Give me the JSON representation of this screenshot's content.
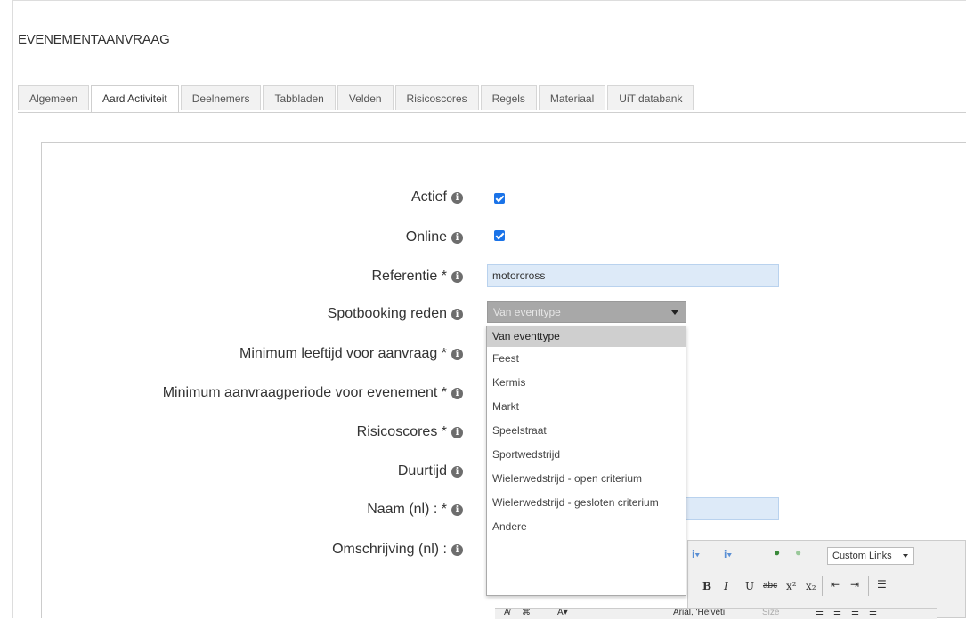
{
  "page": {
    "title": "EVENEMENTAANVRAAG"
  },
  "tabs": [
    {
      "label": "Algemeen",
      "active": false
    },
    {
      "label": "Aard Activiteit",
      "active": true
    },
    {
      "label": "Deelnemers",
      "active": false
    },
    {
      "label": "Tabbladen",
      "active": false
    },
    {
      "label": "Velden",
      "active": false
    },
    {
      "label": "Risicoscores",
      "active": false
    },
    {
      "label": "Regels",
      "active": false
    },
    {
      "label": "Materiaal",
      "active": false
    },
    {
      "label": "UiT databank",
      "active": false
    }
  ],
  "form": {
    "actief": {
      "label": "Actief",
      "checked": true
    },
    "online": {
      "label": "Online",
      "checked": true
    },
    "referentie": {
      "label": "Referentie *",
      "value": "motorcross"
    },
    "spotbooking": {
      "label": "Spotbooking reden",
      "selected": "Van eventtype",
      "options": [
        "Van eventtype",
        "Feest",
        "Kermis",
        "Markt",
        "Speelstraat",
        "Sportwedstrijd",
        "Wielerwedstrijd - open criterium",
        "Wielerwedstrijd - gesloten criterium",
        "Andere"
      ]
    },
    "min_leeftijd": {
      "label": "Minimum leeftijd voor aanvraag *"
    },
    "min_periode": {
      "label": "Minimum aanvraagperiode voor evenement *"
    },
    "risicoscores": {
      "label": "Risicoscores *"
    },
    "duurtijd": {
      "label": "Duurtijd"
    },
    "naam": {
      "label": "Naam (nl) : *"
    },
    "omschrijving": {
      "label": "Omschrijving (nl) :"
    }
  },
  "editor": {
    "custom_links": "Custom Links",
    "font": "Arial, 'Helveti",
    "size": "Size",
    "bold": "B",
    "italic": "I",
    "underline": "U",
    "strike": "abc"
  },
  "colors": {
    "checkbox": "#1a73e8",
    "input_bg": "#ddeaf8",
    "select_bg": "#a8a8a8"
  }
}
